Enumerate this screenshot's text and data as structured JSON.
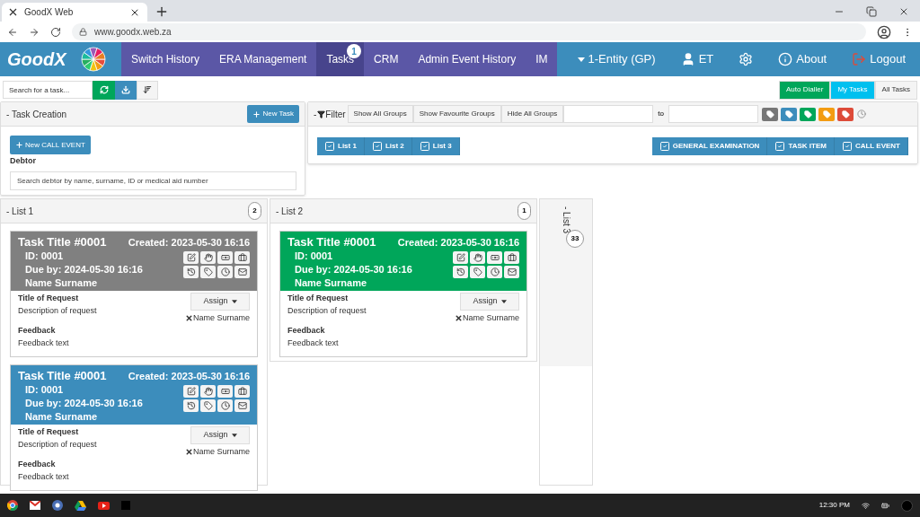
{
  "browser": {
    "tab_title": "GoodX Web",
    "url": "www.goodx.web.za"
  },
  "nav": {
    "logo": "GoodX",
    "items": [
      {
        "label": "Switch History",
        "selected": false
      },
      {
        "label": "ERA Management",
        "selected": false
      },
      {
        "label": "Tasks",
        "selected": true,
        "badge": "1"
      },
      {
        "label": "CRM",
        "selected": false
      },
      {
        "label": "Admin Event History",
        "selected": false
      },
      {
        "label": "IM",
        "selected": false
      }
    ],
    "right": [
      {
        "kind": "dropdown",
        "label": "1-Entity (GP)"
      },
      {
        "kind": "user",
        "label": "ET"
      },
      {
        "kind": "settings"
      },
      {
        "kind": "info",
        "label": "About"
      },
      {
        "kind": "logout",
        "label": "Logout"
      }
    ]
  },
  "toolbar": {
    "search_placeholder": "Search for a task...",
    "views": [
      {
        "label": "Auto Dialler",
        "color": "#00a65a"
      },
      {
        "label": "My Tasks",
        "color": "#00c0ef"
      },
      {
        "label": "All Tasks",
        "color": "#f4f4f4"
      }
    ]
  },
  "task_creation": {
    "title": "- Task Creation",
    "new_task": "New Task",
    "new_call_event": "New CALL EVENT",
    "debtor_label": "Debtor",
    "debtor_placeholder": "Search debtor by name, surname, ID or medical aid number"
  },
  "filter": {
    "dash": "-",
    "title": "Filter",
    "group_buttons": [
      "Show All Groups",
      "Show Favourite Groups",
      "Hide All Groups"
    ],
    "to_label": "to",
    "tags": [
      {
        "color": "#777777"
      },
      {
        "color": "#3c8dbc"
      },
      {
        "color": "#00a65a"
      },
      {
        "color": "#f39c12"
      },
      {
        "color": "#dd4b39"
      }
    ],
    "lists": [
      {
        "label": "List 1",
        "checked": true
      },
      {
        "label": "List 2",
        "checked": true
      },
      {
        "label": "List 3",
        "checked": true
      }
    ],
    "types": [
      {
        "label": "GENERAL EXAMINATION",
        "checked": true
      },
      {
        "label": "TASK ITEM",
        "checked": true
      },
      {
        "label": "CALL EVENT",
        "checked": true
      }
    ]
  },
  "lists": [
    {
      "title": "- List 1",
      "count": "2",
      "collapsed": false,
      "cards": [
        {
          "color": "#808080",
          "title": "Task Title #0001",
          "created": "Created: 2023-05-30 16:16",
          "id": "ID: 0001",
          "due": "Due by: 2024-05-30 16:16",
          "name": "Name Surname",
          "request_title": "Title of Request",
          "request_desc": "Description of request",
          "assign": "Assign",
          "assignee": "Name Surname",
          "feedback_title": "Feedback",
          "feedback": "Feedback text"
        },
        {
          "color": "#3c8dbc",
          "title": "Task Title #0001",
          "created": "Created: 2023-05-30 16:16",
          "id": "ID: 0001",
          "due": "Due by: 2024-05-30 16:16",
          "name": "Name Surname",
          "request_title": "Title of Request",
          "request_desc": "Description of request",
          "assign": "Assign",
          "assignee": "Name Surname",
          "feedback_title": "Feedback",
          "feedback": "Feedback text"
        }
      ]
    },
    {
      "title": "- List 2",
      "count": "1",
      "collapsed": false,
      "cards": [
        {
          "color": "#00a65a",
          "title": "Task Title #0001",
          "created": "Created: 2023-05-30 16:16",
          "id": "ID: 0001",
          "due": "Due by: 2024-05-30 16:16",
          "name": "Name Surname",
          "request_title": "Title of Request",
          "request_desc": "Description of request",
          "assign": "Assign",
          "assignee": "Name Surname",
          "feedback_title": "Feedback",
          "feedback": "Feedback text"
        }
      ]
    },
    {
      "title": "- List 3",
      "count": "33",
      "collapsed": true
    }
  ],
  "taskbar": {
    "time": "12:30 PM"
  }
}
